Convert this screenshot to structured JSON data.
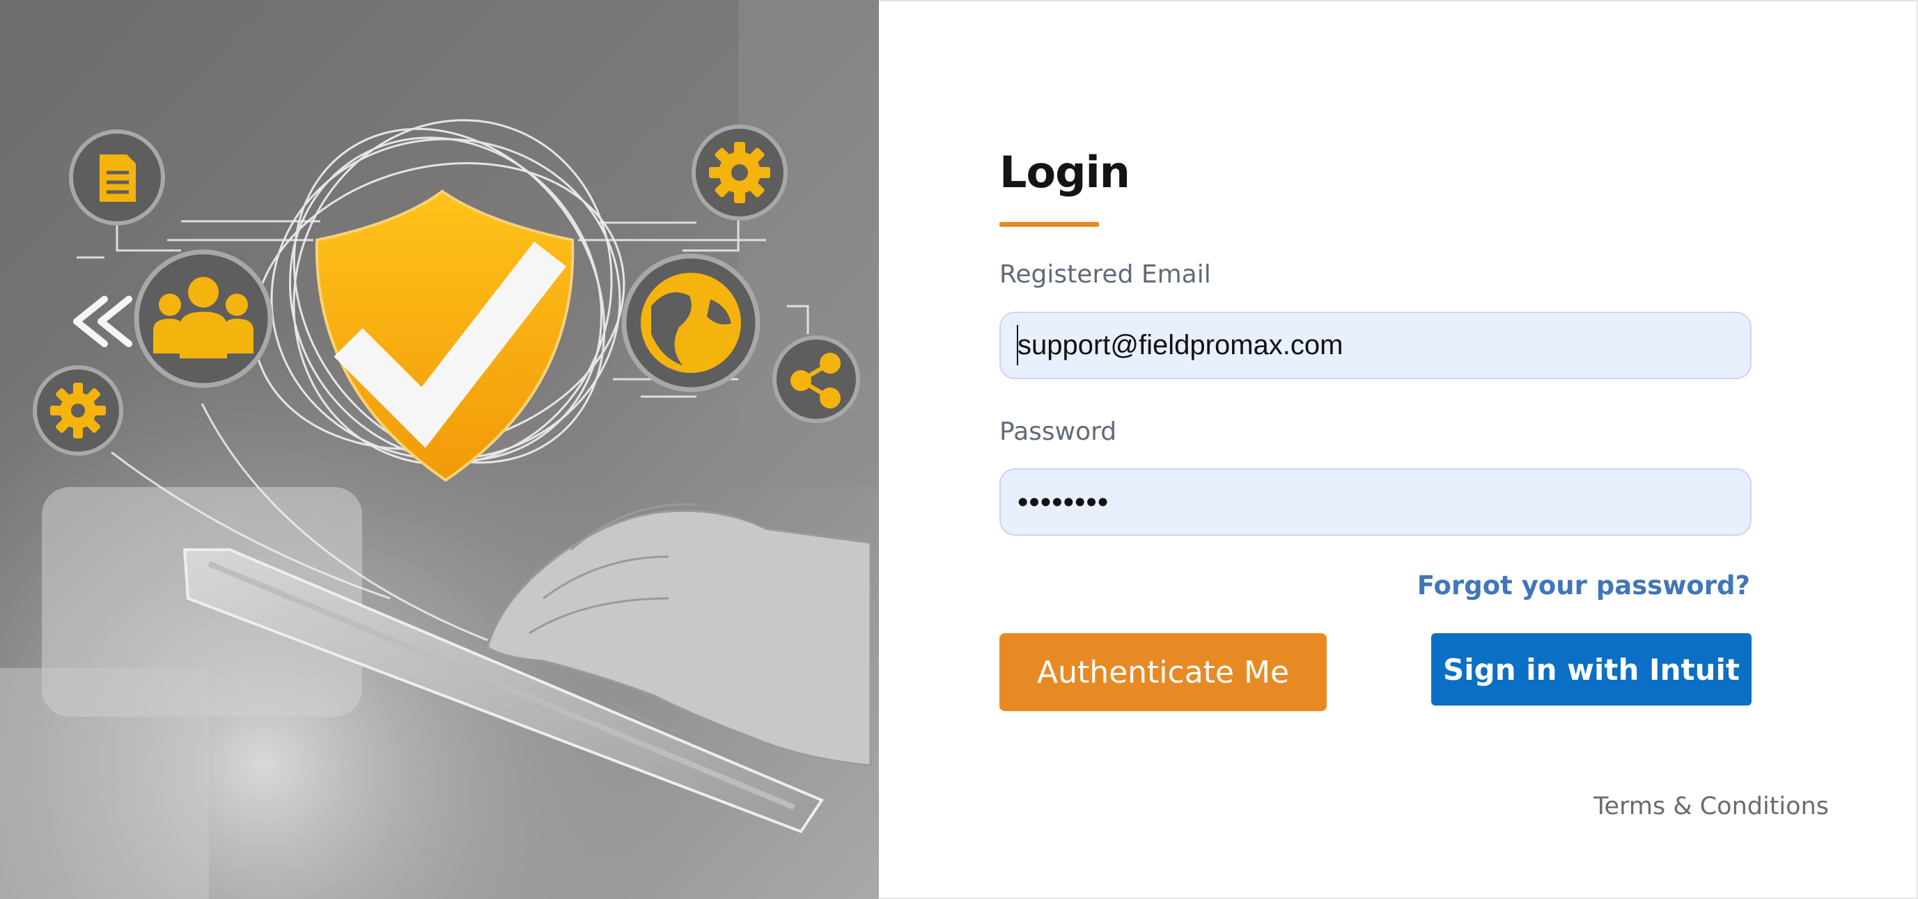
{
  "login": {
    "title": "Login",
    "email_label": "Registered Email",
    "email_value": "support@fieldpromax.com",
    "password_label": "Password",
    "password_masked": "••••••••",
    "forgot_password": "Forgot your password?",
    "authenticate_button": "Authenticate Me",
    "intuit_button": "Sign in with Intuit",
    "terms": "Terms & Conditions"
  },
  "colors": {
    "accent_orange": "#e88a24",
    "intuit_blue": "#0b6fc6",
    "link_blue": "#3f77b8",
    "input_bg": "#e8effd",
    "icon_yellow": "#f5b40d"
  },
  "hero": {
    "icons": [
      "document-icon",
      "gear-icon",
      "people-icon",
      "shield-check-icon",
      "globe-icon",
      "share-icon",
      "gear-icon",
      "double-chevron-left-icon"
    ]
  }
}
